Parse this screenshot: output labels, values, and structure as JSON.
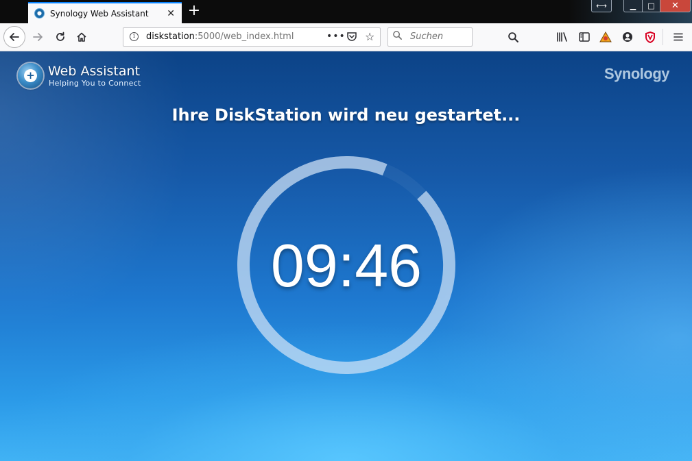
{
  "browser": {
    "tab": {
      "title": "Synology Web Assistant",
      "close_glyph": "✕"
    },
    "new_tab_glyph": "+",
    "window_controls": {
      "resize": "⟷",
      "minimize": "▁",
      "maximize": "□",
      "close": "✕"
    },
    "nav": {
      "back_icon": "arrow-left-icon",
      "forward_icon": "arrow-right-icon",
      "reload_icon": "reload-icon",
      "home_icon": "home-icon"
    },
    "url": {
      "host": "diskstation",
      "path": ":5000/web_index.html"
    },
    "search": {
      "placeholder": "Suchen"
    },
    "toolbar_icons": [
      "search-icon",
      "library-icon",
      "sidebar-icon",
      "extension-icon",
      "account-icon",
      "shield-icon",
      "menu-icon"
    ]
  },
  "page": {
    "brand": {
      "title": "Web Assistant",
      "subtitle": "Helping You to Connect"
    },
    "vendor_logo": "Synology",
    "headline": "Ihre DiskStation wird neu gestartet...",
    "countdown": "09:46",
    "progress_fraction": 0.93,
    "colors": {
      "accent": "#0a84ff",
      "page_top": "#0c4387",
      "page_bottom": "#41b3f5",
      "close_button": "#c9473b"
    }
  }
}
